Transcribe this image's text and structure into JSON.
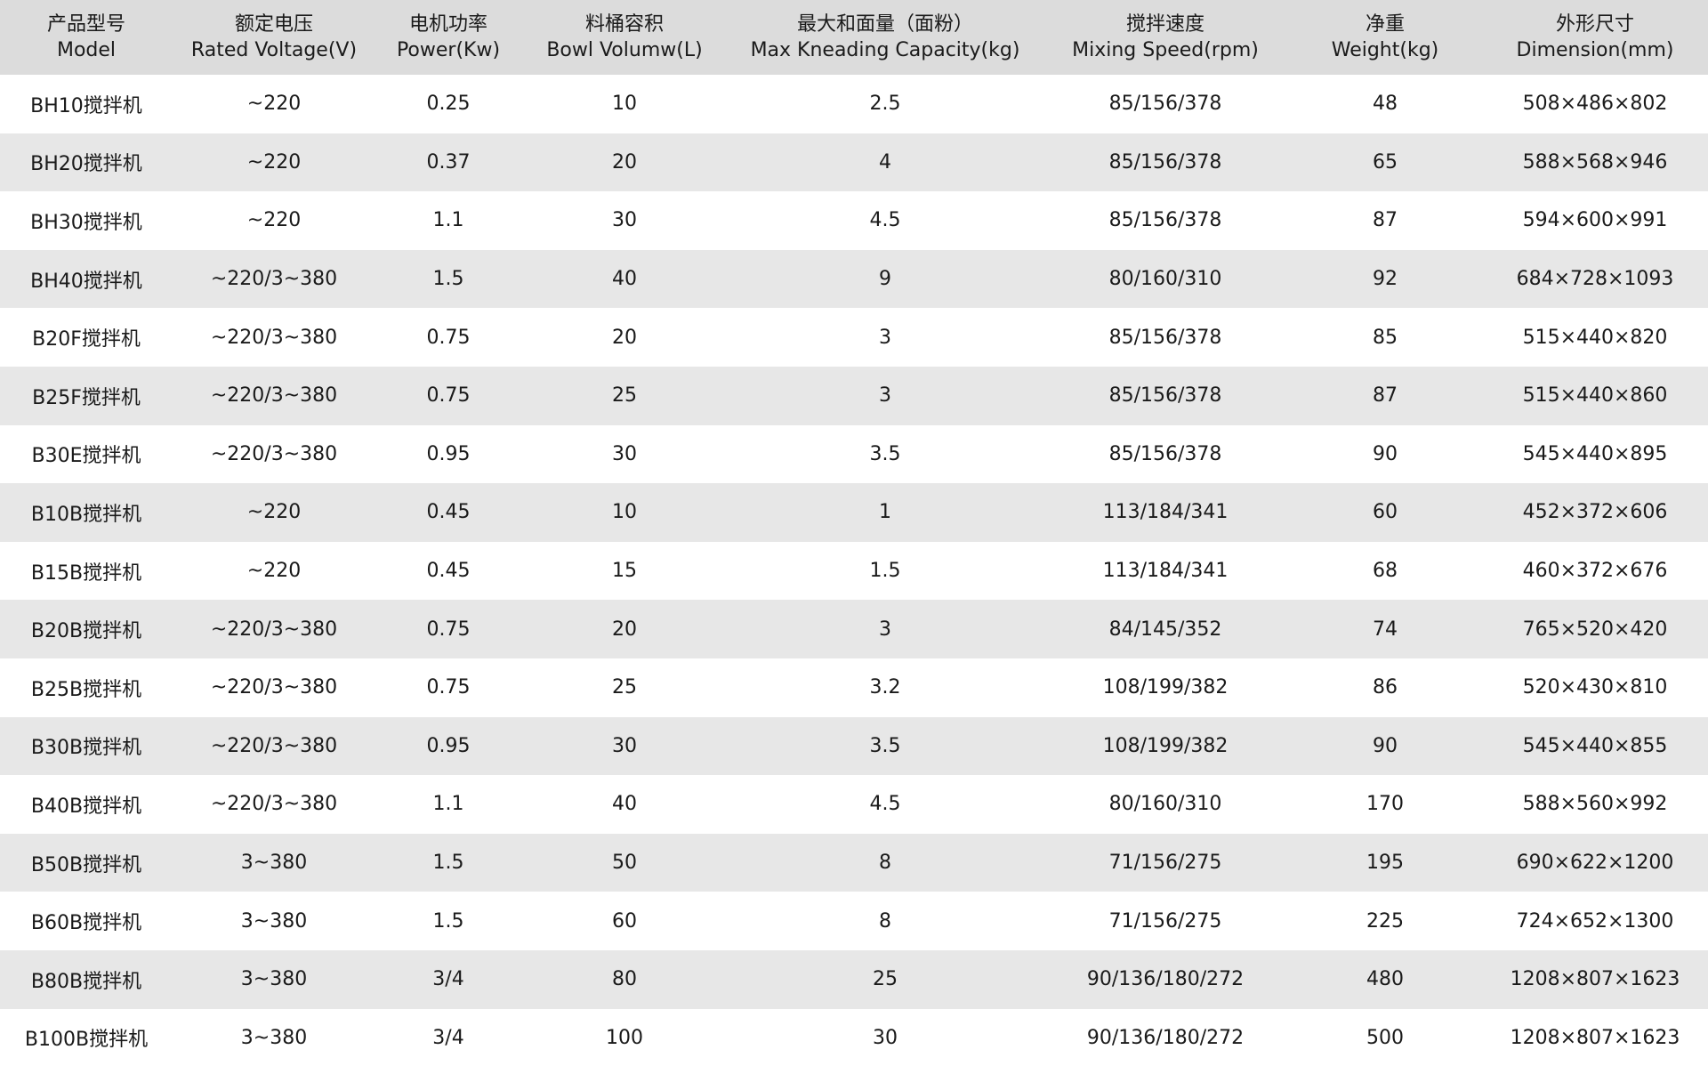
{
  "table": {
    "headers": [
      {
        "zh": "产品型号",
        "en": "Model"
      },
      {
        "zh": "额定电压",
        "en": "Rated Voltage(V)"
      },
      {
        "zh": "电机功率",
        "en": "Power(Kw)"
      },
      {
        "zh": "料桶容积",
        "en": "Bowl Volumw(L)"
      },
      {
        "zh": "最大和面量（面粉）",
        "en": "Max Kneading Capacity(kg)"
      },
      {
        "zh": "搅拌速度",
        "en": "Mixing Speed(rpm)"
      },
      {
        "zh": "净重",
        "en": "Weight(kg)"
      },
      {
        "zh": "外形尺寸",
        "en": "Dimension(mm)"
      }
    ],
    "rows": [
      [
        "BH10搅拌机",
        "~220",
        "0.25",
        "10",
        "2.5",
        "85/156/378",
        "48",
        "508×486×802"
      ],
      [
        "BH20搅拌机",
        "~220",
        "0.37",
        "20",
        "4",
        "85/156/378",
        "65",
        "588×568×946"
      ],
      [
        "BH30搅拌机",
        "~220",
        "1.1",
        "30",
        "4.5",
        "85/156/378",
        "87",
        "594×600×991"
      ],
      [
        "BH40搅拌机",
        "~220/3~380",
        "1.5",
        "40",
        "9",
        "80/160/310",
        "92",
        "684×728×1093"
      ],
      [
        "B20F搅拌机",
        "~220/3~380",
        "0.75",
        "20",
        "3",
        "85/156/378",
        "85",
        "515×440×820"
      ],
      [
        "B25F搅拌机",
        "~220/3~380",
        "0.75",
        "25",
        "3",
        "85/156/378",
        "87",
        "515×440×860"
      ],
      [
        "B30E搅拌机",
        "~220/3~380",
        "0.95",
        "30",
        "3.5",
        "85/156/378",
        "90",
        "545×440×895"
      ],
      [
        "B10B搅拌机",
        "~220",
        "0.45",
        "10",
        "1",
        "113/184/341",
        "60",
        "452×372×606"
      ],
      [
        "B15B搅拌机",
        "~220",
        "0.45",
        "15",
        "1.5",
        "113/184/341",
        "68",
        "460×372×676"
      ],
      [
        "B20B搅拌机",
        "~220/3~380",
        "0.75",
        "20",
        "3",
        "84/145/352",
        "74",
        "765×520×420"
      ],
      [
        "B25B搅拌机",
        "~220/3~380",
        "0.75",
        "25",
        "3.2",
        "108/199/382",
        "86",
        "520×430×810"
      ],
      [
        "B30B搅拌机",
        "~220/3~380",
        "0.95",
        "30",
        "3.5",
        "108/199/382",
        "90",
        "545×440×855"
      ],
      [
        "B40B搅拌机",
        "~220/3~380",
        "1.1",
        "40",
        "4.5",
        "80/160/310",
        "170",
        "588×560×992"
      ],
      [
        "B50B搅拌机",
        "3~380",
        "1.5",
        "50",
        "8",
        "71/156/275",
        "195",
        "690×622×1200"
      ],
      [
        "B60B搅拌机",
        "3~380",
        "1.5",
        "60",
        "8",
        "71/156/275",
        "225",
        "724×652×1300"
      ],
      [
        "B80B搅拌机",
        "3~380",
        "3/4",
        "80",
        "25",
        "90/136/180/272",
        "480",
        "1208×807×1623"
      ],
      [
        "B100B搅拌机",
        "3~380",
        "3/4",
        "100",
        "30",
        "90/136/180/272",
        "500",
        "1208×807×1623"
      ]
    ],
    "colors": {
      "header_bg": "#dcdcdc",
      "row_alt_bg": "#e7e7e7",
      "row_bg": "#ffffff",
      "text": "#1a1a1a"
    }
  }
}
